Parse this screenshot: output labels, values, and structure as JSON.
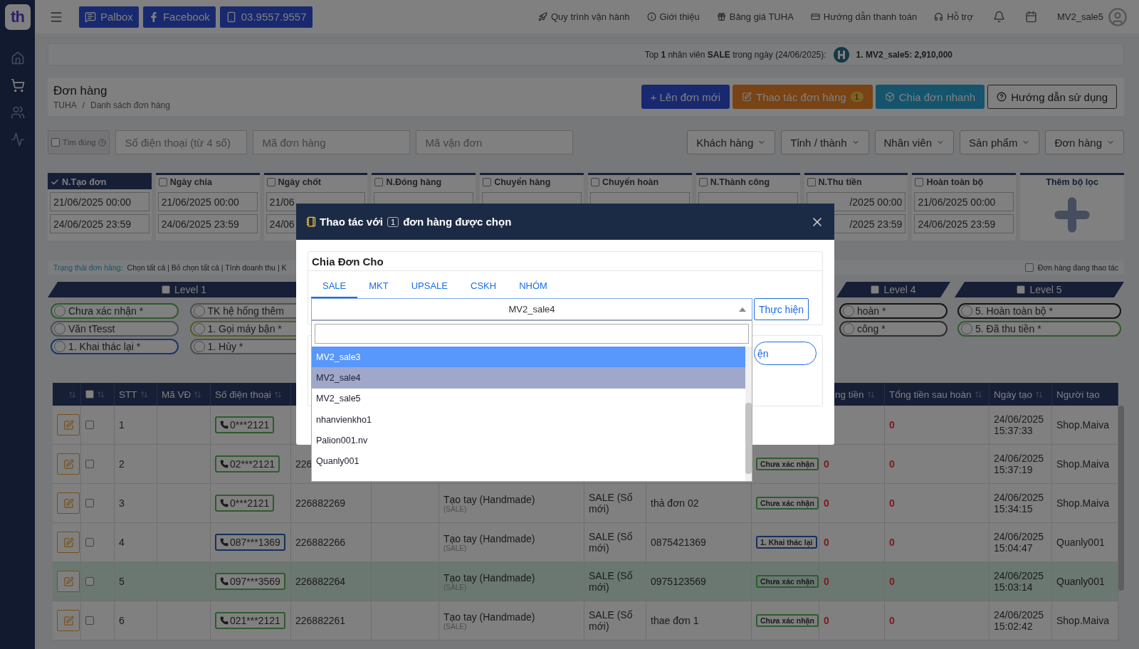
{
  "sidebar": {
    "logo": "th",
    "items": [
      {
        "kind": "home",
        "selected": false
      },
      {
        "kind": "cart",
        "selected": true
      },
      {
        "kind": "users",
        "selected": false
      },
      {
        "kind": "activity",
        "selected": false
      }
    ]
  },
  "topbar": {
    "links": [
      {
        "kind": "chat",
        "label": "Palbox"
      },
      {
        "kind": "facebook",
        "label": "Facebook"
      },
      {
        "kind": "phone",
        "label": "03.9557.9557"
      }
    ],
    "nav": [
      {
        "kind": "rocket",
        "label": "Quy trình vận hành"
      },
      {
        "kind": "info",
        "label": "Giới thiệu"
      },
      {
        "kind": "gift",
        "label": "Bảng giá TUHA"
      },
      {
        "kind": "card",
        "label": "Hướng dẫn thanh toán"
      },
      {
        "kind": "headset",
        "label": "Hỗ trợ"
      }
    ],
    "user": "MV2_sale5"
  },
  "ranking": {
    "text": "Top **1** nhân viên **SALE** trong ngày (24/06/2025):",
    "leader": "1. MV2_sale5: 2,910,000"
  },
  "header": {
    "title": "Đơn hàng",
    "breadcrumb": [
      "TUHA",
      "/",
      "Danh sách đơn hàng"
    ],
    "actions": [
      {
        "kind": "primary",
        "label": "+ Lên đơn mới"
      },
      {
        "kind": "warning",
        "label": "Thao tác đơn hàng",
        "badge": "1"
      },
      {
        "kind": "info",
        "label": "Chia đơn nhanh"
      },
      {
        "kind": "outline",
        "label": "Hướng dẫn sử dụng"
      }
    ]
  },
  "search": {
    "exact": {
      "label": "Tìm đúng",
      "checked": false
    },
    "fields": [
      {
        "placeholder": "Số điện thoại (từ 4 số)"
      },
      {
        "placeholder": "Mã đơn hàng"
      },
      {
        "placeholder": "Mã vận đơn"
      }
    ],
    "dropdowns": [
      "Khách hàng",
      "Tỉnh / thành",
      "Nhân viên",
      "Sản phẩm",
      "Đơn hàng"
    ]
  },
  "date_filters": [
    {
      "label": "N.Tạo đơn",
      "checked": true,
      "values": [
        "21/06/2025 00:00",
        "24/06/2025 23:59"
      ]
    },
    {
      "label": "Ngày chia",
      "checked": false,
      "values": [
        "21/06/2025 00:00",
        "24/06/2025 23:59"
      ]
    },
    {
      "label": "Ngày chốt",
      "checked": false,
      "values": [
        "21/06",
        "24/06"
      ]
    },
    {
      "label": "N.Đóng hàng",
      "checked": false
    },
    {
      "label": "Chuyển hàng",
      "checked": false
    },
    {
      "label": "Chuyển hoàn",
      "checked": false
    },
    {
      "label": "N.Thành công",
      "checked": false
    },
    {
      "label": "N.Thu tiền",
      "checked": false,
      "cut_left": true,
      "values": [
        "/2025 00:00",
        "/2025 23:59"
      ]
    },
    {
      "label": "Hoàn toàn bộ",
      "checked": false,
      "values": [
        "21/06/2025 00:00",
        "24/06/2025 23:59"
      ]
    }
  ],
  "add_filter": "Thêm bộ lọc",
  "status_bar": {
    "label": "Trạng thái đơn hàng:",
    "actions": "Chọn tất cả | Bỏ chọn tất cả | Tính doanh thu | K",
    "in_progress": {
      "label": "Đơn hàng đang thao tác",
      "checked": false
    }
  },
  "levels": [
    {
      "label": "Level 1",
      "checked": false,
      "columns": [
        [
          {
            "label": "Chưa xác nhận *",
            "color": "#2e5c2e"
          },
          {
            "label": "Văn tTesst",
            "color": "#4d5053"
          },
          {
            "label": "1. Khai thác lại *",
            "color": "#17376b"
          }
        ],
        [
          {
            "label": "TK hệ hống thêm",
            "color": "#4d5053"
          },
          {
            "label": "1. Gọi máy bận *",
            "color": "#5a5c1d"
          },
          {
            "label": "1. Hủy *",
            "color": "#4d5053"
          }
        ]
      ]
    },
    {
      "label": "Level 4",
      "checked": false,
      "columns": [
        [
          {
            "label": "hoàn *",
            "color": "#151515"
          },
          {
            "label": "công *",
            "color": "#2d2d2d"
          }
        ]
      ]
    },
    {
      "label": "Level 5",
      "checked": false,
      "columns": [
        [
          {
            "label": "5. Hoàn toàn bộ *",
            "color": "#151515"
          },
          {
            "label": "5. Đã thu tiền *",
            "color": "#2e5c2e"
          }
        ]
      ]
    }
  ],
  "table": {
    "select_all": {
      "checked": false
    },
    "columns": [
      {
        "label": "STT"
      },
      {
        "label": "Mã VĐ"
      },
      {
        "label": "Số điện thoại"
      },
      {
        "label": "ng tiền",
        "cut_left": true
      },
      {
        "label": "Tổng tiền sau hoàn"
      },
      {
        "label": "Ngày tạo"
      },
      {
        "label": "Người tạo"
      }
    ],
    "rows": [
      {
        "no": "1",
        "checked": false,
        "highlighted": false,
        "phone": {
          "number": "0***2121",
          "color": "#2e5c2e"
        },
        "amount_after": "0",
        "created": "24/06/2025 15:37:33",
        "creator": "Shop.Maiva"
      },
      {
        "no": "2",
        "checked": false,
        "highlighted": false,
        "phone": {
          "number": "02***2121",
          "color": "#2e5c2e"
        },
        "order_code": "226",
        "status": {
          "label": "Chưa xác nhận",
          "color": "#2e5c2e"
        },
        "amount": "0",
        "amount_after": "0",
        "created": "24/06/2025 15:37:19",
        "creator": "Shop.Maiva"
      },
      {
        "no": "3",
        "checked": false,
        "highlighted": false,
        "phone": {
          "number": "0***2121",
          "color": "#2e5c2e"
        },
        "order_code": "226882269",
        "source": "Tạo tay (Handmade)",
        "source_tag": "(SALE)",
        "type": "SALE (Số mới)",
        "note": "thả đơn 02",
        "status": {
          "label": "Chưa xác nhận",
          "color": "#2e5c2e"
        },
        "amount": "0",
        "amount_after": "0",
        "created": "24/06/2025 15:34:15",
        "creator": "Shop.Maiva"
      },
      {
        "no": "4",
        "checked": false,
        "highlighted": false,
        "phone": {
          "number": "087***1369",
          "color": "#17305a"
        },
        "order_code": "226882266",
        "source": "Tạo tay (Handmade)",
        "source_tag": "(SALE)",
        "type": "SALE (Số mới)",
        "note": "0875421369",
        "status": {
          "label": "1. Khai thác lại",
          "color": "#17305a"
        },
        "amount": "0",
        "amount_after": "0",
        "created": "24/06/2025 15:04:47",
        "creator": "Quanly001"
      },
      {
        "no": "5",
        "checked": false,
        "highlighted": true,
        "phone": {
          "number": "097***3569",
          "color": "#2e5c2e"
        },
        "order_code": "226882264",
        "source": "Tạo tay (Handmade)",
        "source_tag": "(SALE)",
        "type": "SALE (Số mới)",
        "note": "0975123569",
        "status": {
          "label": "Chưa xác nhận",
          "color": "#2e5c2e"
        },
        "amount": "0",
        "amount_after": "0",
        "created": "24/06/2025 15:03:14",
        "creator": "Quanly001"
      },
      {
        "no": "6",
        "checked": false,
        "highlighted": false,
        "phone": {
          "number": "021***2121",
          "color": "#2e5c2e"
        },
        "order_code": "226882261",
        "source": "Tạo tay (Handmade)",
        "source_tag": "(SALE)",
        "type": "SALE (Số mới)",
        "note": "thae đơn 1",
        "status": {
          "label": "Chưa xác nhận",
          "color": "#2e5c2e"
        },
        "amount": "0",
        "amount_after": "0",
        "created": "24/06/2025 15:02:42",
        "creator": "Shop.Maiva"
      }
    ]
  },
  "modal": {
    "title_before": "Thao tác với",
    "count": "1",
    "title_after": "đơn hàng được chọn",
    "card_title": "Chia Đơn Cho",
    "tabs": [
      {
        "label": "SALE",
        "selected": true
      },
      {
        "label": "MKT",
        "selected": false
      },
      {
        "label": "UPSALE",
        "selected": false
      },
      {
        "label": "CSKH",
        "selected": false
      },
      {
        "label": "NHÓM",
        "selected": false
      }
    ],
    "select": {
      "value": "MV2_sale4",
      "expanded": true
    },
    "submit": "Thực hiện",
    "second_button": "ện",
    "options": [
      {
        "label": "MV2_sale3",
        "selected": false,
        "highlighted": true
      },
      {
        "label": "MV2_sale4",
        "selected": true,
        "highlighted": false
      },
      {
        "label": "MV2_sale5",
        "selected": false,
        "highlighted": false
      },
      {
        "label": "nhanvienkho1",
        "selected": false,
        "highlighted": false
      },
      {
        "label": "Palion001.nv",
        "selected": false,
        "highlighted": false
      },
      {
        "label": "Quanly001",
        "selected": false,
        "highlighted": false
      }
    ]
  }
}
